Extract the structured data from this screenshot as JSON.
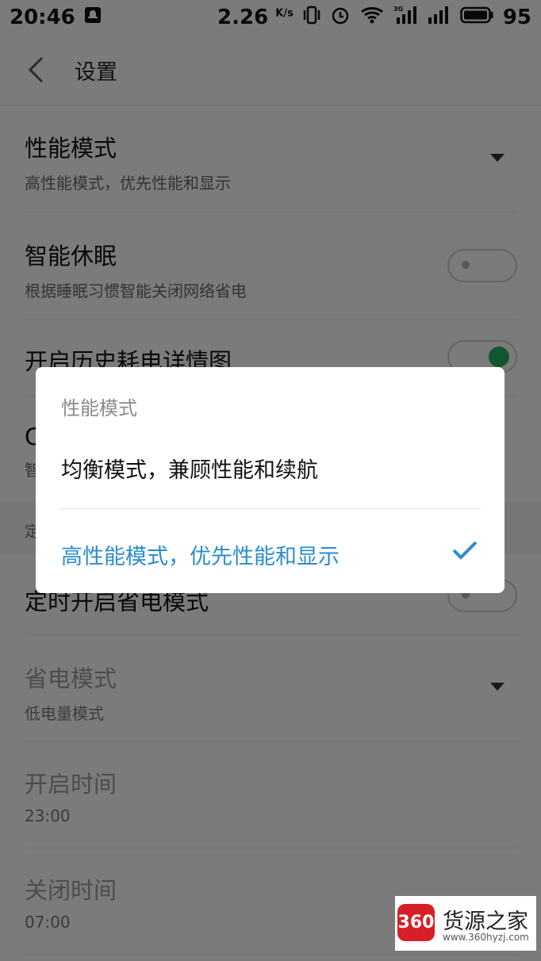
{
  "status": {
    "time": "20:46",
    "speed": "2.26",
    "speed_unit": "K/s",
    "network": "3G",
    "battery": "95"
  },
  "appbar": {
    "title": "设置"
  },
  "settings": [
    {
      "title": "性能模式",
      "subtitle": "高性能模式，优先性能和显示"
    },
    {
      "title": "智能休眠",
      "subtitle": "根据睡眠习惯智能关闭网络省电",
      "toggle": false
    },
    {
      "title": "开启历史耗电详情图",
      "toggle": true
    },
    {
      "title": "C",
      "subtitle": "智"
    },
    {
      "section": "定"
    },
    {
      "title": "定时开启省电模式",
      "toggle": false
    },
    {
      "title": "省电模式",
      "subtitle": "低电量模式"
    },
    {
      "title": "开启时间",
      "subtitle": "23:00"
    },
    {
      "title": "关闭时间",
      "subtitle": "07:00"
    }
  ],
  "dialog": {
    "title": "性能模式",
    "options": [
      {
        "label": "均衡模式，兼顾性能和续航",
        "selected": false
      },
      {
        "label": "高性能模式，优先性能和显示",
        "selected": true
      }
    ]
  },
  "watermark": {
    "logo": "360",
    "brand": "货源之家",
    "url": "www.360hyzj.com"
  },
  "colors": {
    "accent": "#2d8ccc",
    "toggle_on": "#27ae60"
  }
}
